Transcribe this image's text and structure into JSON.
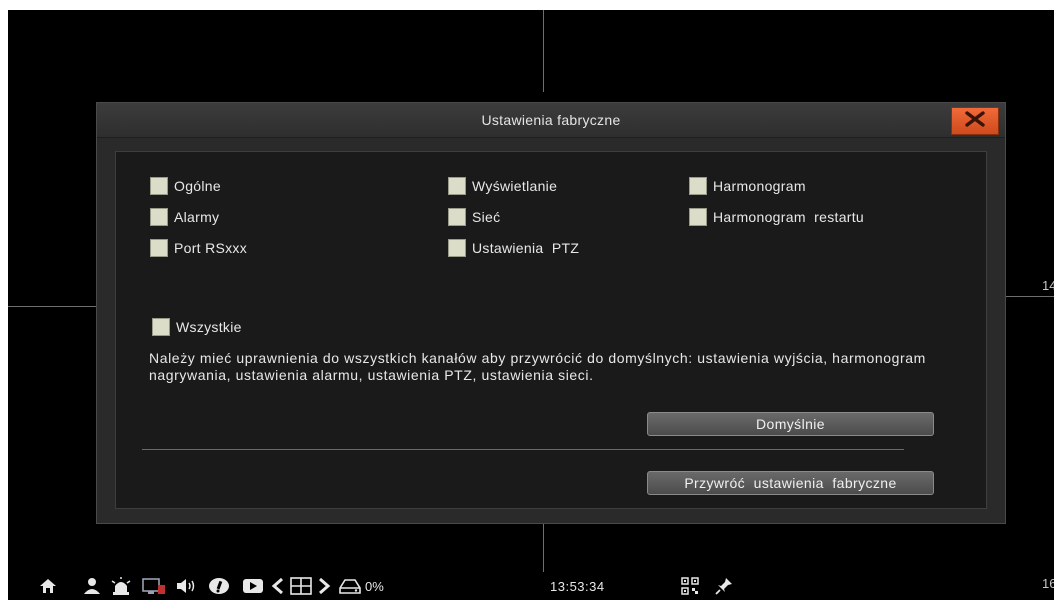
{
  "dialog": {
    "title": "Ustawienia fabryczne",
    "options": {
      "ogolne": "Ogólne",
      "wyswietlanie": "Wyświetlanie",
      "harmonogram": "Harmonogram",
      "alarmy": "Alarmy",
      "siec": "Sieć",
      "harmonogram_restartu": "Harmonogram  restartu",
      "port_rsxxx": "Port RSxxx",
      "ustawienia_ptz": "Ustawienia  PTZ",
      "wszystkie": "Wszystkie"
    },
    "note": "Należy mieć uprawnienia do wszystkich kanałów aby przywrócić do domyślnych: ustawienia wyjścia, harmonogram nagrywania, ustawienia alarmu, ustawienia PTZ, ustawienia sieci.",
    "default_button": "Domyślnie",
    "restore_button": "Przywróć  ustawienia  fabryczne"
  },
  "channels": {
    "right_mid": "14",
    "right_bottom": "16"
  },
  "taskbar": {
    "percent": "0%",
    "time": "13:53:34"
  },
  "colors": {
    "close_button": "#e05a2a",
    "checkbox": "#dcddc9",
    "background": "#000000"
  }
}
